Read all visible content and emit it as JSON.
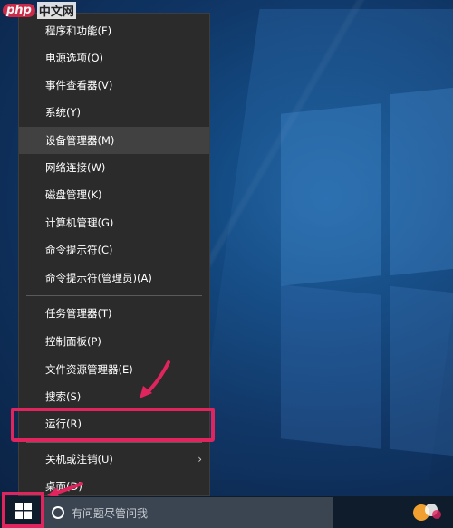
{
  "watermark": {
    "php": "php",
    "cn": "中文网"
  },
  "menu": {
    "items": [
      {
        "label": "程序和功能(F)",
        "hover": false
      },
      {
        "label": "电源选项(O)",
        "hover": false
      },
      {
        "label": "事件查看器(V)",
        "hover": false
      },
      {
        "label": "系统(Y)",
        "hover": false
      },
      {
        "label": "设备管理器(M)",
        "hover": true
      },
      {
        "label": "网络连接(W)",
        "hover": false
      },
      {
        "label": "磁盘管理(K)",
        "hover": false
      },
      {
        "label": "计算机管理(G)",
        "hover": false
      },
      {
        "label": "命令提示符(C)",
        "hover": false
      },
      {
        "label": "命令提示符(管理员)(A)",
        "hover": false
      },
      {
        "label": "任务管理器(T)",
        "hover": false
      },
      {
        "label": "控制面板(P)",
        "hover": false
      },
      {
        "label": "文件资源管理器(E)",
        "hover": false
      },
      {
        "label": "搜索(S)",
        "hover": false
      },
      {
        "label": "运行(R)",
        "hover": false
      },
      {
        "label": "关机或注销(U)",
        "hover": false,
        "submenu": true
      },
      {
        "label": "桌面(D)",
        "hover": false
      }
    ],
    "submenu_arrow": "›"
  },
  "taskbar": {
    "search_placeholder": "有问题尽管问我",
    "start_icon": "windows-logo-icon",
    "search_icon": "cortana-circle-icon"
  },
  "annotation_color": "#e0245e"
}
